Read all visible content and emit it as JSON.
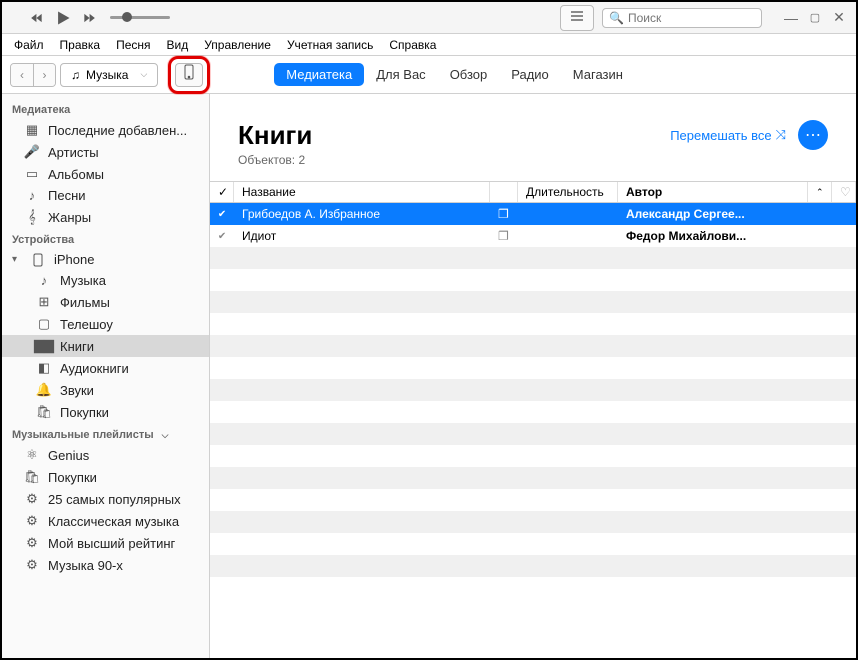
{
  "titlebar": {
    "search_placeholder": "Поиск"
  },
  "menubar": [
    "Файл",
    "Правка",
    "Песня",
    "Вид",
    "Управление",
    "Учетная запись",
    "Справка"
  ],
  "toolbar": {
    "library_dropdown": "Музыка",
    "tabs": [
      {
        "label": "Медиатека",
        "active": true
      },
      {
        "label": "Для Вас",
        "active": false
      },
      {
        "label": "Обзор",
        "active": false
      },
      {
        "label": "Радио",
        "active": false
      },
      {
        "label": "Магазин",
        "active": false
      }
    ]
  },
  "sidebar": {
    "sections": {
      "library": {
        "header": "Медиатека",
        "items": [
          "Последние добавлен...",
          "Артисты",
          "Альбомы",
          "Песни",
          "Жанры"
        ]
      },
      "devices": {
        "header": "Устройства",
        "device_name": "iPhone",
        "items": [
          "Музыка",
          "Фильмы",
          "Телешоу",
          "Книги",
          "Аудиокниги",
          "Звуки",
          "Покупки"
        ],
        "selected_index": 3
      },
      "playlists": {
        "header": "Музыкальные плейлисты",
        "items": [
          "Genius",
          "Покупки",
          "25 самых популярных",
          "Классическая музыка",
          "Мой высший рейтинг",
          "Музыка 90-х"
        ]
      }
    }
  },
  "content": {
    "title": "Книги",
    "subtitle": "Объектов: 2",
    "shuffle_label": "Перемешать все",
    "columns": {
      "name": "Название",
      "duration": "Длительность",
      "author": "Автор"
    },
    "rows": [
      {
        "name": "Грибоедов А. Избранное",
        "author": "Александр Сергее...",
        "selected": true
      },
      {
        "name": "Идиот",
        "author": "Федор Михайлови...",
        "selected": false
      }
    ]
  }
}
